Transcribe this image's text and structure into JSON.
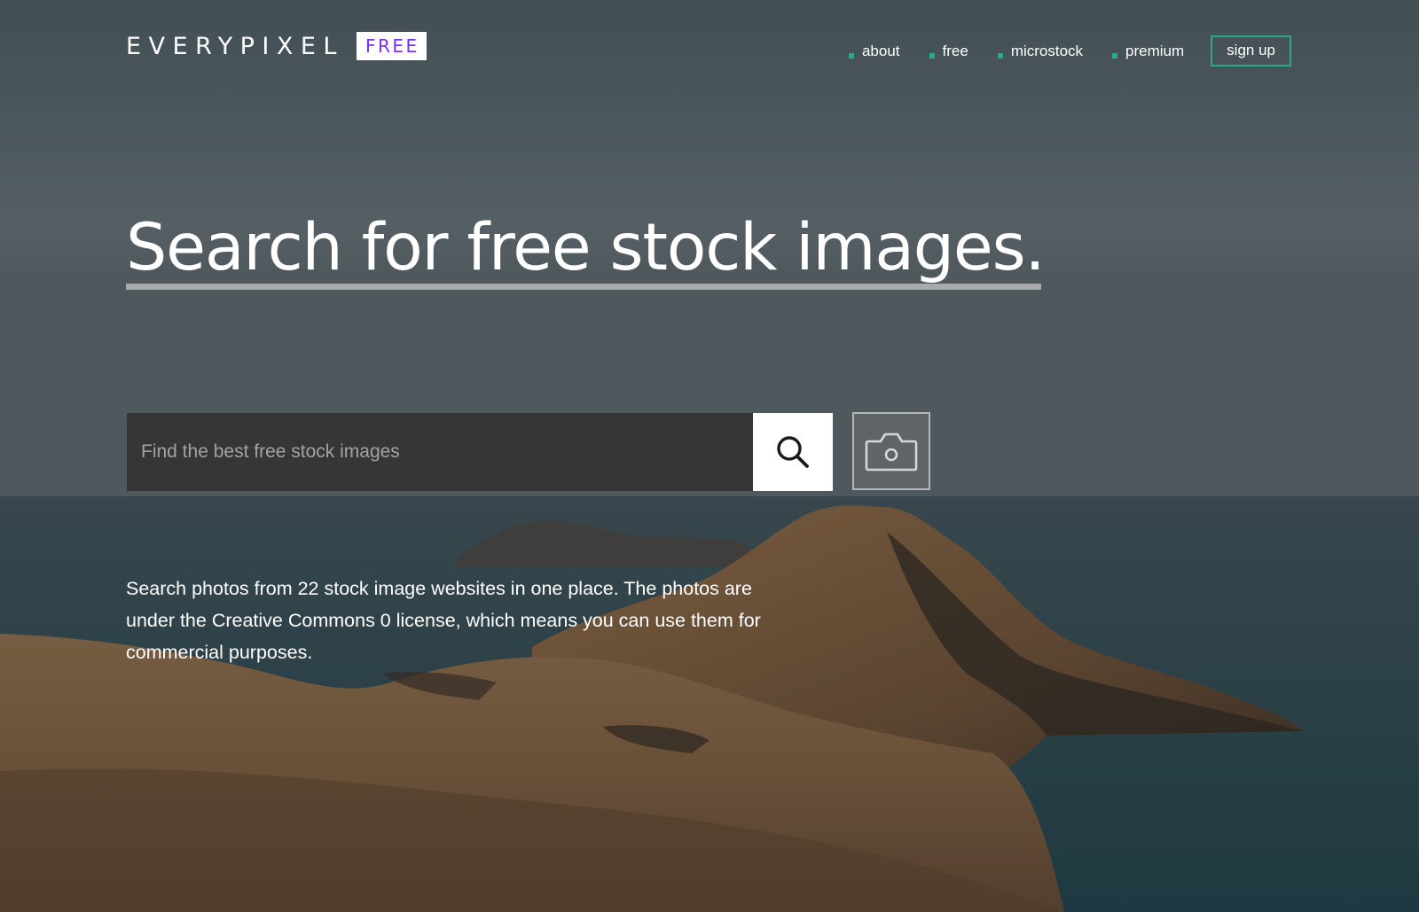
{
  "header": {
    "logo": {
      "wordmark": "EVERYPIXEL",
      "badge": "FREE"
    },
    "nav": [
      {
        "label": "about"
      },
      {
        "label": "free"
      },
      {
        "label": "microstock"
      },
      {
        "label": "premium"
      }
    ],
    "signup_label": "sign up"
  },
  "hero": {
    "title": "Search for free stock images."
  },
  "search": {
    "placeholder": "Find the best free stock images",
    "value": "",
    "search_icon": "magnifier-icon",
    "camera_icon": "camera-icon"
  },
  "description": "Search photos from 22 stock image websites in one place. The photos are under the Creative Commons 0 license, which means you can use them for commercial purposes.",
  "colors": {
    "accent": "#2aa98a",
    "badge_text": "#7b2ff7",
    "search_bg": "#353637",
    "underline": "#a7aaad"
  }
}
